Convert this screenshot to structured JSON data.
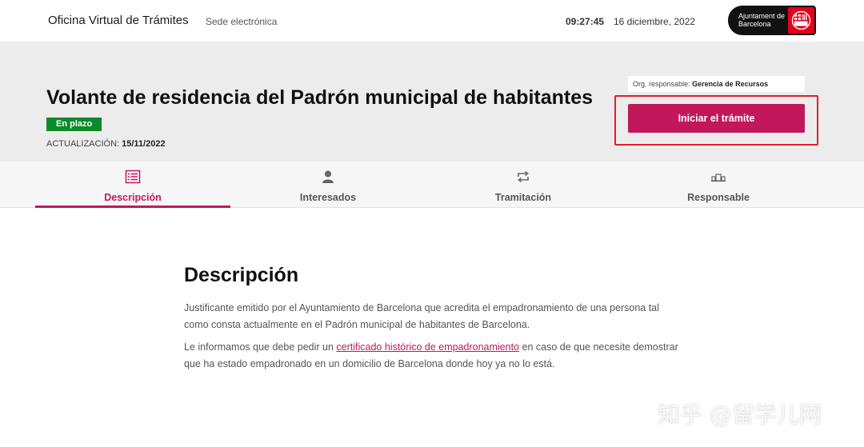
{
  "header": {
    "site_title": "Oficina Virtual de Trámites",
    "site_subtitle": "Sede electrónica",
    "time": "09:27:45",
    "date": "16 diciembre, 2022",
    "logo_text": "Ajuntament de Barcelona"
  },
  "hero": {
    "title": "Volante de residencia del Padrón municipal de habitantes",
    "status": "En plazo",
    "update_label": "ACTUALIZACIÓN:",
    "update_value": "15/11/2022",
    "org_label": "Org. responsable:",
    "org_value": "Gerencia de Recursos",
    "start_button": "Iniciar el trámite"
  },
  "tabs": [
    {
      "label": "Descripción",
      "icon": "list-icon",
      "active": true
    },
    {
      "label": "Interesados",
      "icon": "person-icon",
      "active": false
    },
    {
      "label": "Tramitación",
      "icon": "cycle-icon",
      "active": false
    },
    {
      "label": "Responsable",
      "icon": "building-icon",
      "active": false
    }
  ],
  "content": {
    "title": "Descripción",
    "para1": "Justificante emitido por el Ayuntamiento de Barcelona que acredita el empadronamiento de una persona tal como consta actualmente en el Padrón municipal de habitantes de Barcelona.",
    "para2_before": "Le informamos que debe pedir un ",
    "para2_link": "certificado histórico de empadronamiento",
    "para2_after": " en caso de que necesite demostrar que ha estado empadronado en un domicilio de Barcelona donde hoy ya no lo está."
  },
  "watermark": "知乎 @留学儿网",
  "colors": {
    "brand": "#c2185b",
    "status_green": "#0b8a2a",
    "highlight_red": "#e0202a"
  }
}
